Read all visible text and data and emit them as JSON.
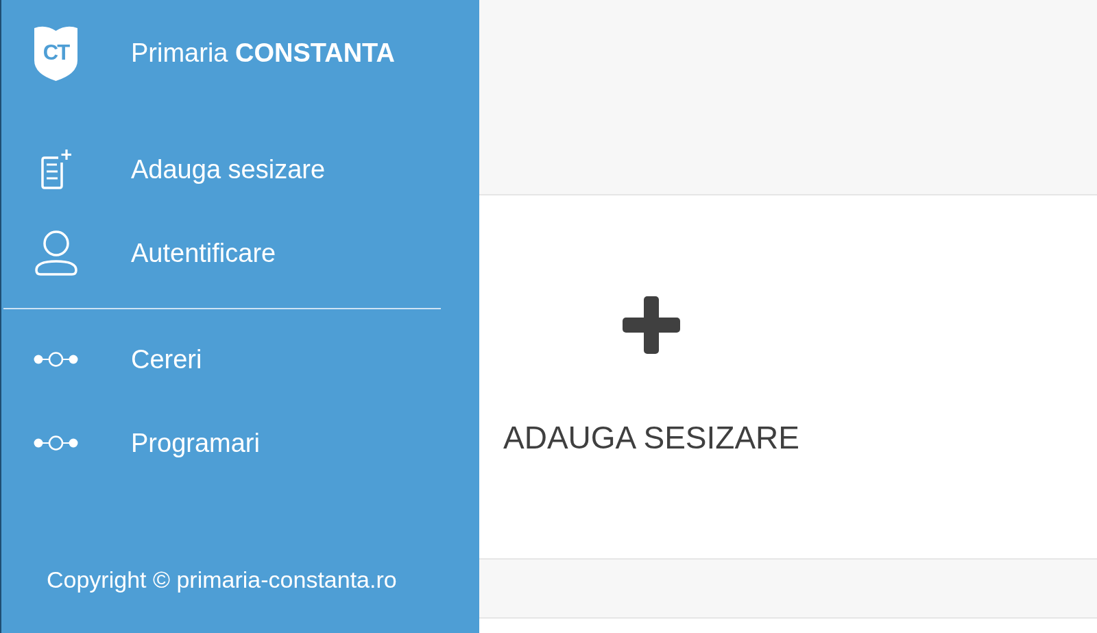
{
  "sidebar": {
    "logo": {
      "text": "CT"
    },
    "brand": "Primaria **CONSTANTA**",
    "menu": [
      {
        "kind": "report",
        "label": "Adauga sesizare"
      },
      {
        "kind": "account",
        "label": "Autentificare"
      }
    ],
    "links": [
      {
        "label": "Cereri"
      },
      {
        "label": "Programari"
      }
    ],
    "copyright": "Copyright © primaria-constanta.ro"
  },
  "main": {
    "action": {
      "label": "ADAUGA SESIZARE"
    }
  }
}
